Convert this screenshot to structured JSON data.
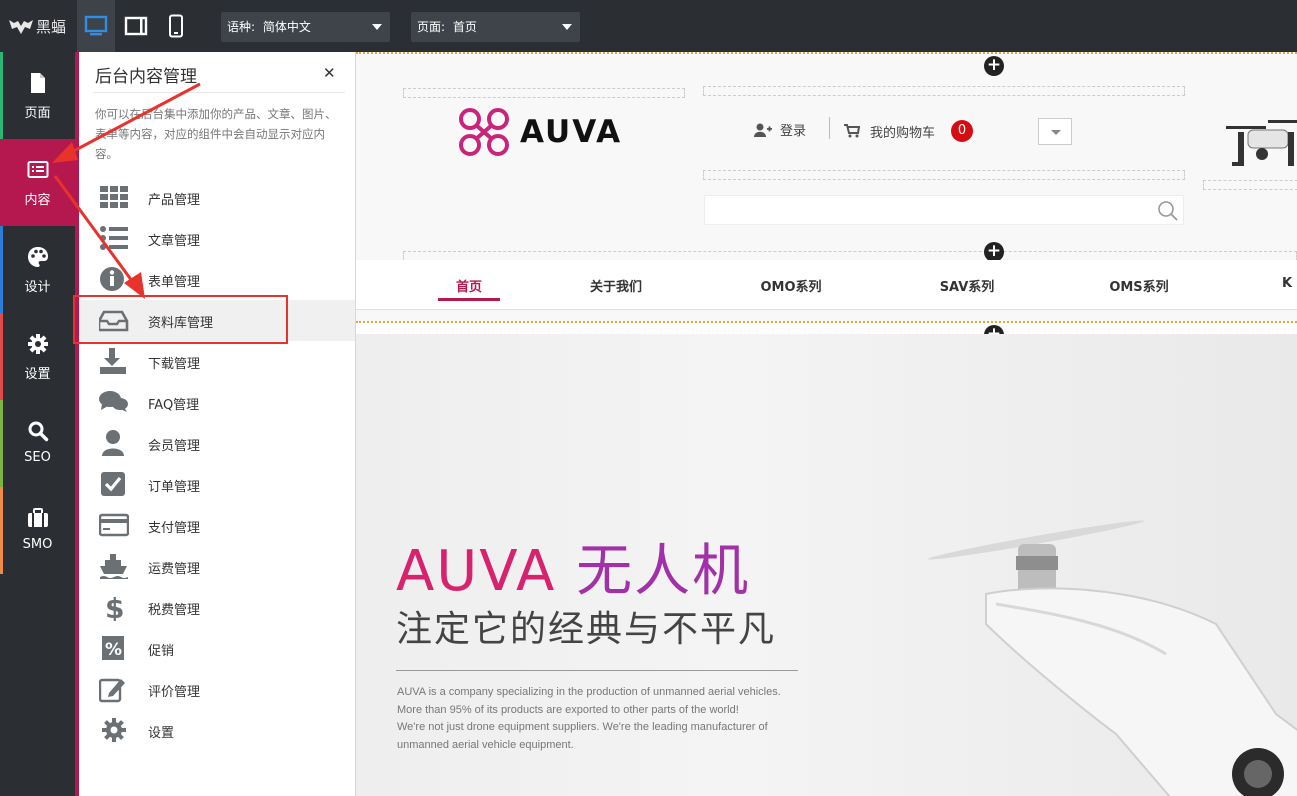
{
  "topbar": {
    "logo_text": "黑蝠",
    "language_label": "语种:",
    "language_value": "简体中文",
    "page_label": "页面:",
    "page_value": "首页"
  },
  "rail": {
    "items": [
      {
        "label": "页面",
        "icon": "page-icon",
        "color": "#2bb673"
      },
      {
        "label": "内容",
        "icon": "content-list-icon",
        "color": "#b4184e"
      },
      {
        "label": "设计",
        "icon": "palette-icon",
        "color": "#2a7dd8"
      },
      {
        "label": "设置",
        "icon": "gear-icon",
        "color": "#e14a4a"
      },
      {
        "label": "SEO",
        "icon": "search-icon",
        "color": "#7cb342"
      },
      {
        "label": "SMO",
        "icon": "briefcase-icon",
        "color": "#f08a48"
      }
    ]
  },
  "panel": {
    "title": "后台内容管理",
    "description": "你可以在后台集中添加你的产品、文章、图片、表单等内容，对应的组件中会自动显示对应内容。",
    "items": [
      {
        "label": "产品管理",
        "icon": "grid-icon"
      },
      {
        "label": "文章管理",
        "icon": "list-icon"
      },
      {
        "label": "表单管理",
        "icon": "info-icon"
      },
      {
        "label": "资料库管理",
        "icon": "inbox-icon"
      },
      {
        "label": "下载管理",
        "icon": "download-icon"
      },
      {
        "label": "FAQ管理",
        "icon": "chat-icon"
      },
      {
        "label": "会员管理",
        "icon": "user-icon"
      },
      {
        "label": "订单管理",
        "icon": "checkbox-icon"
      },
      {
        "label": "支付管理",
        "icon": "credit-card-icon"
      },
      {
        "label": "运费管理",
        "icon": "ship-icon"
      },
      {
        "label": "税费管理",
        "icon": "dollar-icon"
      },
      {
        "label": "促销",
        "icon": "percent-icon"
      },
      {
        "label": "评价管理",
        "icon": "edit-icon"
      },
      {
        "label": "设置",
        "icon": "gear-icon"
      }
    ]
  },
  "site": {
    "brand": "AUVA",
    "login": "登录",
    "cart": "我的购物车",
    "cart_count": "0",
    "nav": [
      "首页",
      "关于我们",
      "OMO系列",
      "SAV系列",
      "OMS系列",
      "K"
    ],
    "hero_title_a": "AUVA",
    "hero_title_b": "无人机",
    "hero_subtitle": "注定它的经典与不平凡",
    "hero_desc": [
      "AUVA is a company specializing in the production of unmanned aerial vehicles.",
      "More than 95% of its products are exported to other parts of the world!",
      "We're not just drone equipment suppliers. We're the leading manufacturer of",
      "unmanned aerial vehicle equipment."
    ]
  },
  "colors": {
    "accent": "#b4184e",
    "annotation": "#e8322c",
    "dark": "#2b2e33"
  }
}
